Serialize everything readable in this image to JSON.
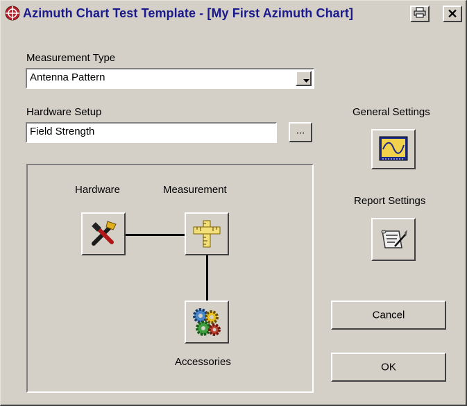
{
  "window": {
    "title": "Azimuth Chart Test Template - [My First Azimuth Chart]",
    "print_icon": "printer-icon",
    "close_symbol": "✕"
  },
  "measurement_type": {
    "label": "Measurement Type",
    "value": "Antenna Pattern"
  },
  "hardware_setup": {
    "label": "Hardware Setup",
    "value": "Field Strength",
    "browse_label": "..."
  },
  "workflow": {
    "hardware_label": "Hardware",
    "measurement_label": "Measurement",
    "accessories_label": "Accessories"
  },
  "settings": {
    "general_label": "General Settings",
    "report_label": "Report Settings"
  },
  "buttons": {
    "cancel": "Cancel",
    "ok": "OK"
  },
  "colors": {
    "dialog_bg": "#d4d0c8",
    "title_text": "#1a1a8c"
  }
}
